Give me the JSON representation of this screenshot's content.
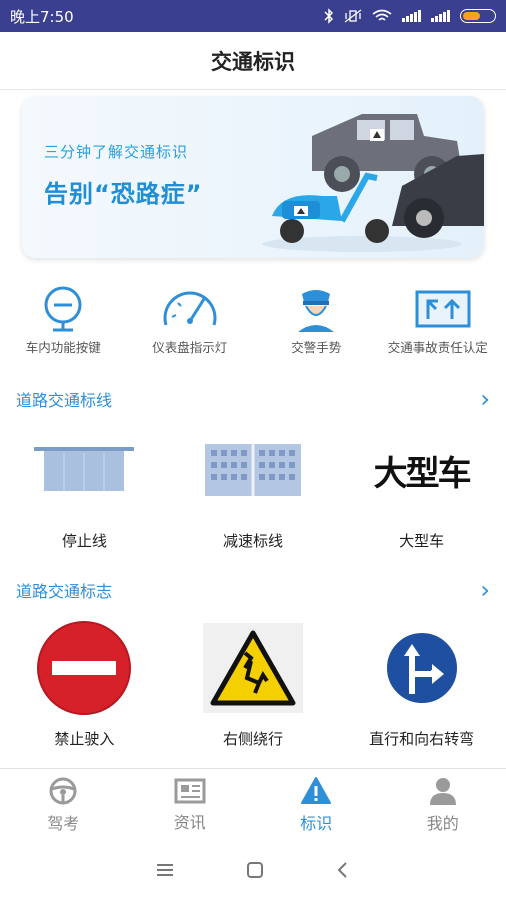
{
  "status_bar": {
    "time": "晚上7:50"
  },
  "header": {
    "title": "交通标识"
  },
  "banner": {
    "line1": "三分钟了解交通标识",
    "line2": "告别“恐路症”"
  },
  "quick_links": [
    {
      "label": "车内功能按键",
      "icon": "steering-button-icon"
    },
    {
      "label": "仪表盘指示灯",
      "icon": "dashboard-gauge-icon"
    },
    {
      "label": "交警手势",
      "icon": "traffic-police-icon"
    },
    {
      "label": "交通事故责任认定",
      "icon": "accident-liability-icon"
    }
  ],
  "road_markings": {
    "title": "道路交通标线",
    "items": [
      {
        "label": "停止线"
      },
      {
        "label": "减速标线"
      },
      {
        "label": "大型车",
        "sample": "大型车"
      }
    ]
  },
  "road_signs": {
    "title": "道路交通标志",
    "items": [
      {
        "label": "禁止驶入"
      },
      {
        "label": "右侧绕行"
      },
      {
        "label": "直行和向右转弯"
      }
    ]
  },
  "tabs": [
    {
      "label": "驾考",
      "icon": "steering-wheel-icon",
      "active": false
    },
    {
      "label": "资讯",
      "icon": "newspaper-icon",
      "active": false
    },
    {
      "label": "标识",
      "icon": "warning-sign-icon",
      "active": true
    },
    {
      "label": "我的",
      "icon": "user-icon",
      "active": false
    }
  ],
  "colors": {
    "accent": "#2e8fd9",
    "status_bar": "#3a3f8f",
    "sign_red": "#d6202a",
    "sign_blue": "#1e4fa0",
    "sign_yellow": "#f5d000"
  }
}
